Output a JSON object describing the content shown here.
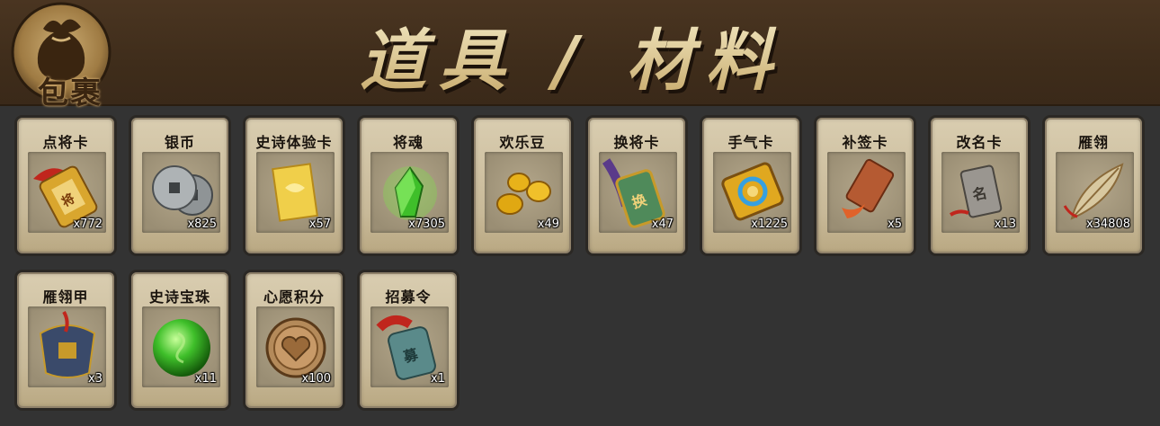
{
  "header": {
    "bag_label": "包裹",
    "title": "道具 / 材料"
  },
  "items": [
    {
      "name": "点将卡",
      "qty": "x772",
      "icon": "general-card-icon"
    },
    {
      "name": "银币",
      "qty": "x825",
      "icon": "silver-coins-icon"
    },
    {
      "name": "史诗体验卡",
      "qty": "x57",
      "icon": "epic-trial-card-icon"
    },
    {
      "name": "将魂",
      "qty": "x7305",
      "icon": "green-crystal-icon"
    },
    {
      "name": "欢乐豆",
      "qty": "x49",
      "icon": "gold-beans-icon"
    },
    {
      "name": "换将卡",
      "qty": "x47",
      "icon": "swap-general-card-icon"
    },
    {
      "name": "手气卡",
      "qty": "x1225",
      "icon": "luck-card-icon"
    },
    {
      "name": "补签卡",
      "qty": "x5",
      "icon": "resign-card-icon"
    },
    {
      "name": "改名卡",
      "qty": "x13",
      "icon": "rename-card-icon"
    },
    {
      "name": "雁翎",
      "qty": "x34808",
      "icon": "feather-icon"
    },
    {
      "name": "雁翎甲",
      "qty": "x3",
      "icon": "armor-icon"
    },
    {
      "name": "史诗宝珠",
      "qty": "x11",
      "icon": "green-orb-icon"
    },
    {
      "name": "心愿积分",
      "qty": "x100",
      "icon": "heart-coin-icon"
    },
    {
      "name": "招募令",
      "qty": "x1",
      "icon": "recruit-token-icon"
    }
  ]
}
